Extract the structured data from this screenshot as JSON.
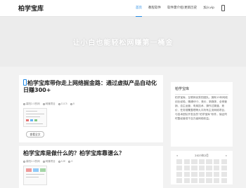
{
  "header": {
    "logo": "柏学宝库",
    "nav": [
      "首页",
      "教程软件",
      "软件需介绍(更新历史",
      "加入vip"
    ],
    "active_index": 0
  },
  "banner": {
    "text": "让小白也能轻松网赚第一桶金"
  },
  "posts": [
    {
      "title": "柏学宝库带你走上网络掘金路：通过虚拟产品自动化日赚300+",
      "meta": [
        "暮阳2.0的网",
        "网赚项目",
        "11C5",
        "0"
      ],
      "more_label": "查看全文"
    },
    {
      "title": "柏学宝库是做什么的？柏学宝库靠谱么？",
      "meta": [
        "暮阳2.0的网",
        "网赚项目",
        "12E",
        "0"
      ]
    }
  ],
  "sidebar": {
    "about_title": "柏学宝库",
    "about_text": "柏学宝库，互联网优秀的团队。拥有15年网络创业经验，精通SEO、竞价、新媒体、全网营销、自主运营、电商技术、操作过渠道、竞价、任务搜集整理等九平所有主流网络项目，与技术团队开发出的“柏学宝库”软件，保证同时整经营成千百万级网络收益。",
    "calendar": {
      "prev": "«",
      "month": "2023年2月",
      "next": "»"
    }
  },
  "colors": {
    "accent": "#1e88e5",
    "page_bg": "#f2f2f2"
  }
}
